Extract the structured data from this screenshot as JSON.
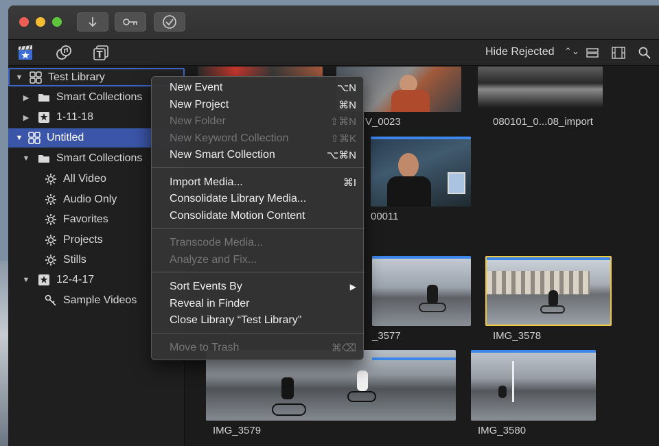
{
  "toolbar": {
    "hide_rejected": "Hide Rejected"
  },
  "sidebar": {
    "items": [
      {
        "label": "Test Library"
      },
      {
        "label": "Smart Collections"
      },
      {
        "label": "1-11-18"
      },
      {
        "label": "Untitled"
      },
      {
        "label": "Smart Collections"
      },
      {
        "label": "All Video"
      },
      {
        "label": "Audio Only"
      },
      {
        "label": "Favorites"
      },
      {
        "label": "Projects"
      },
      {
        "label": "Stills"
      },
      {
        "label": "12-4-17"
      },
      {
        "label": "Sample Videos"
      }
    ]
  },
  "browser": {
    "clips": [
      {
        "label": "V_0023"
      },
      {
        "label": "080101_0...08_import"
      },
      {
        "label": "00011"
      },
      {
        "label": "_3577"
      },
      {
        "label": "IMG_3578"
      },
      {
        "label": "IMG_3579"
      },
      {
        "label": "IMG_3580"
      }
    ]
  },
  "context_menu": {
    "items": [
      {
        "label": "New Event",
        "shortcut": "⌥N"
      },
      {
        "label": "New Project",
        "shortcut": "⌘N"
      },
      {
        "label": "New Folder",
        "shortcut": "⇧⌘N"
      },
      {
        "label": "New Keyword Collection",
        "shortcut": "⇧⌘K"
      },
      {
        "label": "New Smart Collection",
        "shortcut": "⌥⌘N"
      },
      {
        "label": "Import Media...",
        "shortcut": "⌘I"
      },
      {
        "label": "Consolidate Library Media..."
      },
      {
        "label": "Consolidate Motion Content"
      },
      {
        "label": "Transcode Media..."
      },
      {
        "label": "Analyze and Fix..."
      },
      {
        "label": "Sort Events By",
        "shortcut": "▶"
      },
      {
        "label": "Reveal in Finder"
      },
      {
        "label": "Close Library “Test Library”"
      },
      {
        "label": "Move to Trash",
        "shortcut": "⌘⌫"
      }
    ]
  },
  "colors": {
    "selection_blue": "#3b55a8",
    "clip_bar_blue": "#3d86ea",
    "selected_clip_border": "#f0c93a"
  }
}
